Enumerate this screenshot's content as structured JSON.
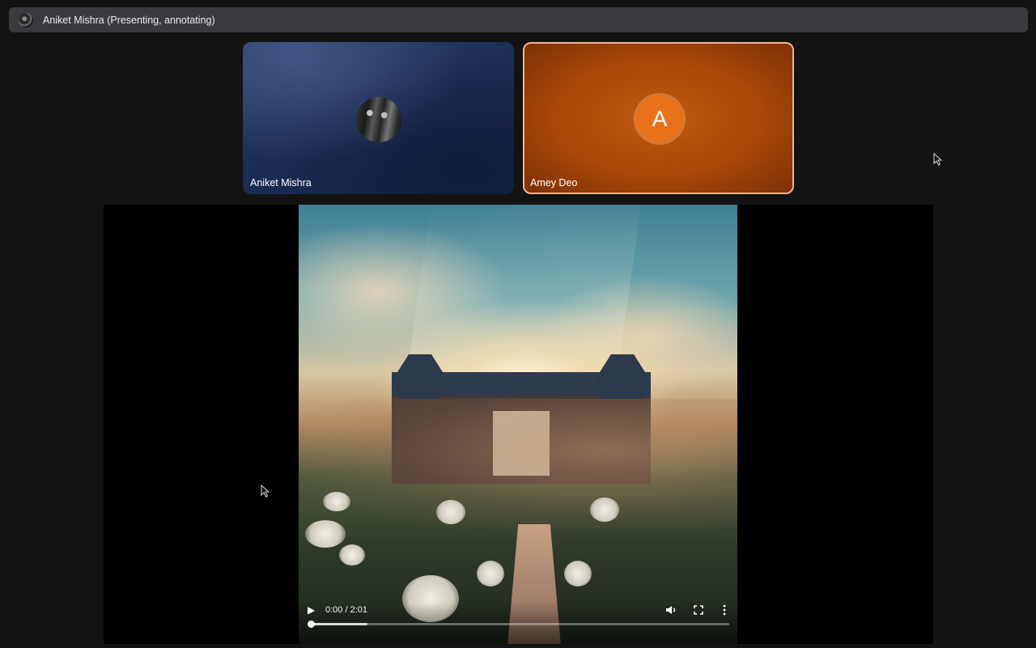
{
  "presenter_bar": {
    "label": "Aniket Mishra (Presenting, annotating)"
  },
  "participants": [
    {
      "name": "Aniket Mishra",
      "avatar": "photo"
    },
    {
      "name": "Amey Deo",
      "avatar_letter": "A",
      "avatar_color": "#e8711a"
    }
  ],
  "video": {
    "time": "0:00 / 2:01",
    "play_icon": "play-icon",
    "volume_icon": "volume-icon",
    "fullscreen_icon": "fullscreen-icon",
    "more_icon": "more-vert-icon",
    "buffered_fraction": 0.135,
    "played_fraction": 0.0
  },
  "colors": {
    "presenter_bar_bg": "#3a3b3e",
    "tile_blue": "#1c2e55",
    "tile_orange": "#a84708",
    "active_border": "#f6b48c"
  }
}
